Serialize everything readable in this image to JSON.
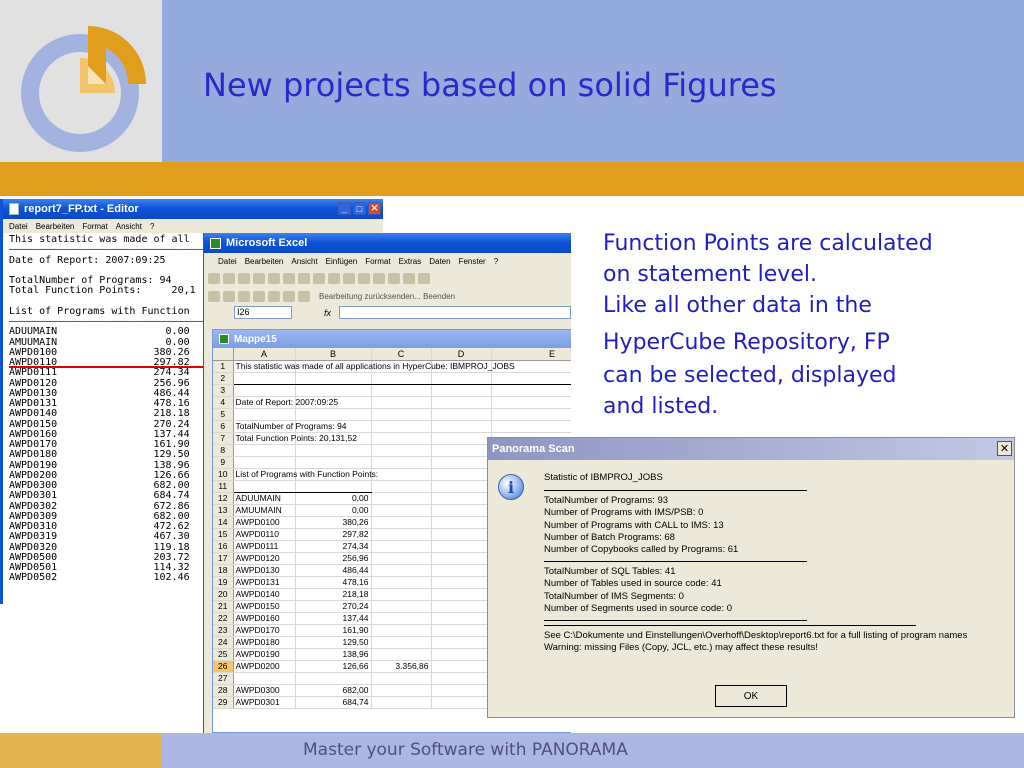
{
  "slide": {
    "title": "New projects based on solid Figures",
    "footer": "Master your Software with PANORAMA",
    "bullets": [
      "Function Points are calculated",
      "on statement level.",
      "Like all other data in the",
      "HyperCube Repository, FP",
      "can be selected, displayed",
      "and listed."
    ],
    "colors": {
      "header_blue": "#95aadd",
      "stripe_orange": "#e09e1c",
      "title_blue": "#2929c9"
    }
  },
  "notepad": {
    "window_title": "report7_FP.txt - Editor",
    "menu": [
      "Datei",
      "Bearbeiten",
      "Format",
      "Ansicht",
      "?"
    ],
    "content": "This statistic was made of all\n―――――――――――――――――――――――――――――――――\nDate of Report: 2007:09:25\n\nTotalNumber of Programs: 94\nTotal Function Points:     20,1\n\nList of Programs with Function\n―――――――――――――――――――――――――――――――――\nADUUMAIN                  0.00\nAMUUMAIN                  0.00\nAWPD0100                380.26\nAWPD0110                297.82\nAWPD0111                274.34\nAWPD0120                256.96\nAWPD0130                486.44\nAWPD0131                478.16\nAWPD0140                218.18\nAWPD0150                270.24\nAWPD0160                137.44\nAWPD0170                161.90\nAWPD0180                129.50\nAWPD0190                138.96\nAWPD0200                126.66\nAWPD0300                682.00\nAWPD0301                684.74\nAWPD0302                672.86\nAWPD0309                682.00\nAWPD0310                472.62\nAWPD0319                467.30\nAWPD0320                119.18\nAWPD0500                203.72\nAWPD0501                114.32\nAWPD0502                102.46"
  },
  "excel": {
    "window_title": "Microsoft Excel",
    "menu": [
      "Datei",
      "Bearbeiten",
      "Ansicht",
      "Einfügen",
      "Format",
      "Extras",
      "Daten",
      "Fenster",
      "?"
    ],
    "review_toolbar": "Bearbeitung zurücksenden... Beenden",
    "name_box": "I26",
    "fx": "fx",
    "workbook_title": "Mappe15",
    "columns": [
      "",
      "A",
      "B",
      "C",
      "D",
      "E"
    ],
    "rows": [
      {
        "n": "1",
        "a": "This statistic was made of all applications in HyperCube: IBMPROJ_JOBS",
        "b": "",
        "c": ""
      },
      {
        "n": "2",
        "a": "",
        "b": "",
        "c": ""
      },
      {
        "n": "3",
        "a": "",
        "b": "",
        "c": ""
      },
      {
        "n": "4",
        "a": "Date of Report: 2007:09:25",
        "b": "",
        "c": ""
      },
      {
        "n": "5",
        "a": "",
        "b": "",
        "c": ""
      },
      {
        "n": "6",
        "a": "TotalNumber of Programs: 94",
        "b": "",
        "c": ""
      },
      {
        "n": "7",
        "a": "Total Function Points:      20,131,52",
        "b": "",
        "c": ""
      },
      {
        "n": "8",
        "a": "",
        "b": "",
        "c": ""
      },
      {
        "n": "9",
        "a": "",
        "b": "",
        "c": ""
      },
      {
        "n": "10",
        "a": "List of Programs with Function Points:",
        "b": "",
        "c": ""
      },
      {
        "n": "11",
        "a": "",
        "b": "",
        "c": ""
      },
      {
        "n": "12",
        "a": "ADUUMAIN",
        "b": "0,00",
        "c": ""
      },
      {
        "n": "13",
        "a": "AMUUMAIN",
        "b": "0,00",
        "c": ""
      },
      {
        "n": "14",
        "a": "AWPD0100",
        "b": "380,26",
        "c": ""
      },
      {
        "n": "15",
        "a": "AWPD0110",
        "b": "297,82",
        "c": ""
      },
      {
        "n": "16",
        "a": "AWPD0111",
        "b": "274,34",
        "c": ""
      },
      {
        "n": "17",
        "a": "AWPD0120",
        "b": "256,96",
        "c": ""
      },
      {
        "n": "18",
        "a": "AWPD0130",
        "b": "486,44",
        "c": ""
      },
      {
        "n": "19",
        "a": "AWPD0131",
        "b": "478,16",
        "c": ""
      },
      {
        "n": "20",
        "a": "AWPD0140",
        "b": "218,18",
        "c": ""
      },
      {
        "n": "21",
        "a": "AWPD0150",
        "b": "270,24",
        "c": ""
      },
      {
        "n": "22",
        "a": "AWPD0160",
        "b": "137,44",
        "c": ""
      },
      {
        "n": "23",
        "a": "AWPD0170",
        "b": "161,90",
        "c": ""
      },
      {
        "n": "24",
        "a": "AWPD0180",
        "b": "129,50",
        "c": ""
      },
      {
        "n": "25",
        "a": "AWPD0190",
        "b": "138,96",
        "c": ""
      },
      {
        "n": "26",
        "a": "AWPD0200",
        "b": "126,66",
        "c": "3.356,86"
      },
      {
        "n": "27",
        "a": "",
        "b": "",
        "c": ""
      },
      {
        "n": "28",
        "a": "AWPD0300",
        "b": "682,00",
        "c": ""
      },
      {
        "n": "29",
        "a": "AWPD0301",
        "b": "684,74",
        "c": ""
      }
    ]
  },
  "dialog": {
    "title": "Panorama Scan",
    "close_glyph": "✕",
    "icon": "info-icon",
    "header": "Statistic of IBMPROJ_JOBS",
    "group1": [
      "TotalNumber of Programs: 93",
      "Number of Programs with IMS/PSB: 0",
      "Number of Programs with CALL to IMS: 13",
      "Number of Batch Programs: 68",
      "Number of Copybooks called by Programs: 61"
    ],
    "group2": [
      "TotalNumber of SQL Tables: 41",
      "Number of Tables used in source code: 41",
      "TotalNumber of IMS Segments: 0",
      "Number of Segments used in source code: 0"
    ],
    "group3": [
      "See C:\\Dokumente und Einstellungen\\Overhoff\\Desktop\\report6.txt for a full listing of program names",
      "Warning: missing Files (Copy, JCL, etc.) may affect these results!"
    ],
    "ok_label": "OK"
  }
}
